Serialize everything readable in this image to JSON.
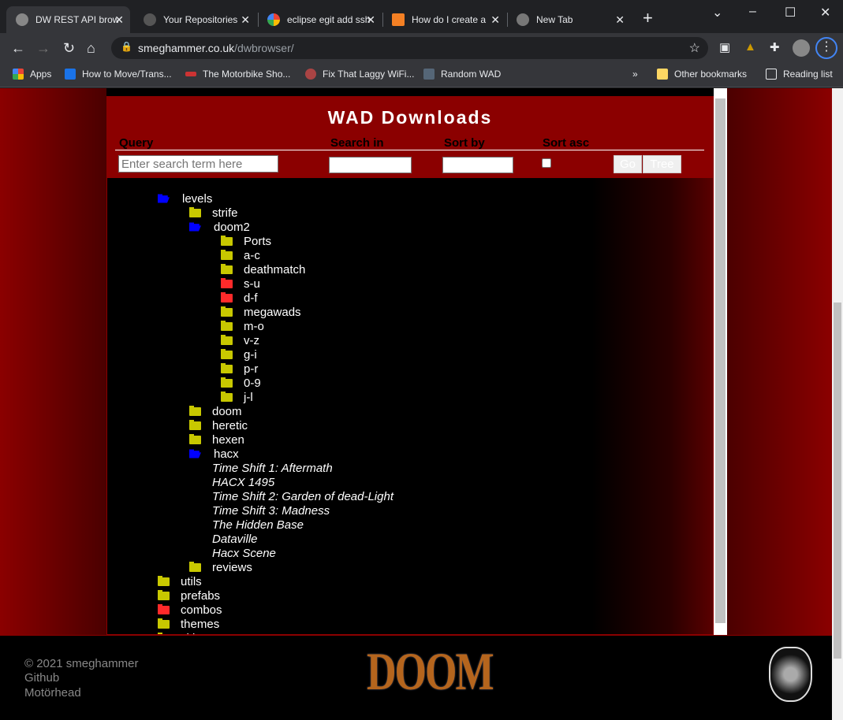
{
  "browser": {
    "tabs": [
      {
        "title": "DW REST API browser",
        "active": true
      },
      {
        "title": "Your Repositories"
      },
      {
        "title": "eclipse egit add ssh"
      },
      {
        "title": "How do I create a"
      },
      {
        "title": "New Tab"
      }
    ],
    "url_host": "smeghammer.co.uk",
    "url_path": "/dwbrowser/",
    "bookmarks": [
      "Apps",
      "How to Move/Trans...",
      "The Motorbike Sho...",
      "Fix That Laggy WiFi...",
      "Random WAD"
    ],
    "other_bookmarks": "Other bookmarks",
    "reading_list": "Reading list"
  },
  "header": {
    "title": "WAD Downloads",
    "query_label": "Query",
    "search_in_label": "Search in",
    "sort_by_label": "Sort by",
    "sort_asc_label": "Sort asc",
    "query_placeholder": "Enter search term here",
    "go_label": "Go",
    "tree_label": "Tree",
    "sort_asc_checked": false
  },
  "colors": {
    "open": "#0000ff",
    "folder": "#c8c800",
    "red": "#ff2a2a",
    "brand": "#8b0000"
  },
  "tree": [
    {
      "label": "levels",
      "depth": 0,
      "icon": "open"
    },
    {
      "label": "strife",
      "depth": 1,
      "icon": "folder"
    },
    {
      "label": "doom2",
      "depth": 1,
      "icon": "open"
    },
    {
      "label": "Ports",
      "depth": 2,
      "icon": "folder"
    },
    {
      "label": "a-c",
      "depth": 2,
      "icon": "folder"
    },
    {
      "label": "deathmatch",
      "depth": 2,
      "icon": "folder"
    },
    {
      "label": "s-u",
      "depth": 2,
      "icon": "red"
    },
    {
      "label": "d-f",
      "depth": 2,
      "icon": "red"
    },
    {
      "label": "megawads",
      "depth": 2,
      "icon": "folder"
    },
    {
      "label": "m-o",
      "depth": 2,
      "icon": "folder"
    },
    {
      "label": "v-z",
      "depth": 2,
      "icon": "folder"
    },
    {
      "label": "g-i",
      "depth": 2,
      "icon": "folder"
    },
    {
      "label": "p-r",
      "depth": 2,
      "icon": "folder"
    },
    {
      "label": "0-9",
      "depth": 2,
      "icon": "folder"
    },
    {
      "label": "j-l",
      "depth": 2,
      "icon": "folder"
    },
    {
      "label": "doom",
      "depth": 1,
      "icon": "folder"
    },
    {
      "label": "heretic",
      "depth": 1,
      "icon": "folder"
    },
    {
      "label": "hexen",
      "depth": 1,
      "icon": "folder"
    },
    {
      "label": "hacx",
      "depth": 1,
      "icon": "open"
    },
    {
      "label": "Time Shift 1: Aftermath",
      "depth": 2,
      "icon": "file"
    },
    {
      "label": "HACX 1495",
      "depth": 2,
      "icon": "file"
    },
    {
      "label": "Time Shift 2: Garden of dead-Light",
      "depth": 2,
      "icon": "file"
    },
    {
      "label": "Time Shift 3: Madness",
      "depth": 2,
      "icon": "file"
    },
    {
      "label": "The Hidden Base",
      "depth": 2,
      "icon": "file"
    },
    {
      "label": "Dataville",
      "depth": 2,
      "icon": "file"
    },
    {
      "label": "Hacx Scene",
      "depth": 2,
      "icon": "file"
    },
    {
      "label": "reviews",
      "depth": 1,
      "icon": "folder"
    },
    {
      "label": "utils",
      "depth": 0,
      "icon": "folder"
    },
    {
      "label": "prefabs",
      "depth": 0,
      "icon": "folder"
    },
    {
      "label": "combos",
      "depth": 0,
      "icon": "red"
    },
    {
      "label": "themes",
      "depth": 0,
      "icon": "folder"
    },
    {
      "label": "skins",
      "depth": 0,
      "icon": "folder"
    }
  ],
  "footer": {
    "copyright": "© 2021 smeghammer",
    "github": "Github",
    "motorhead": "Motörhead",
    "logo_text": "DOOM"
  }
}
